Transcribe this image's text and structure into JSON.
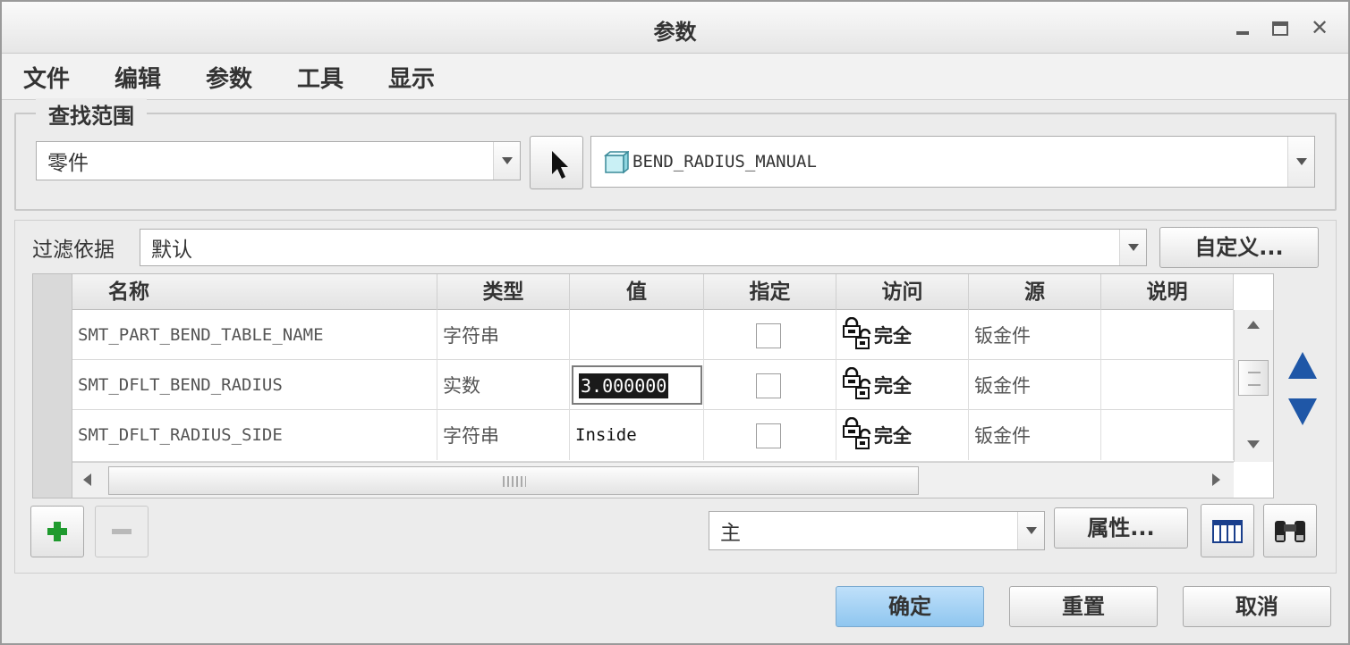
{
  "window": {
    "title": "参数"
  },
  "menu": [
    "文件",
    "编辑",
    "参数",
    "工具",
    "显示"
  ],
  "lookin": {
    "legend": "查找范围",
    "scope_value": "零件",
    "model_value": "BEND_RADIUS_MANUAL"
  },
  "filter": {
    "label": "过滤依据",
    "value": "默认",
    "customize_label": "自定义..."
  },
  "table": {
    "columns": [
      "名称",
      "类型",
      "值",
      "指定",
      "访问",
      "源",
      "说明"
    ],
    "rows": [
      {
        "name": "SMT_PART_BEND_TABLE_NAME",
        "type": "字符串",
        "value": "",
        "designated": false,
        "access": "完全",
        "source": "钣金件",
        "description": ""
      },
      {
        "name": "SMT_DFLT_BEND_RADIUS",
        "type": "实数",
        "value": "3.000000",
        "designated": false,
        "access": "完全",
        "source": "钣金件",
        "description": "",
        "editing": true
      },
      {
        "name": "SMT_DFLT_RADIUS_SIDE",
        "type": "字符串",
        "value": "Inside",
        "designated": false,
        "access": "完全",
        "source": "钣金件",
        "description": ""
      }
    ]
  },
  "bottom_toolbar": {
    "view_value": "主",
    "properties_label": "属性..."
  },
  "buttons": {
    "ok": "确定",
    "reset": "重置",
    "cancel": "取消"
  },
  "icons": {
    "lock": "lock-icon",
    "add": "plus-icon",
    "remove": "minus-icon",
    "columns": "table-columns-icon",
    "search": "binoculars-icon",
    "model": "cube-icon",
    "pointer": "arrow-pointer-icon"
  },
  "colors": {
    "accent_blue": "#1f57a7",
    "add_green": "#1f9a2e",
    "ok_button": "#9fcdf2"
  }
}
